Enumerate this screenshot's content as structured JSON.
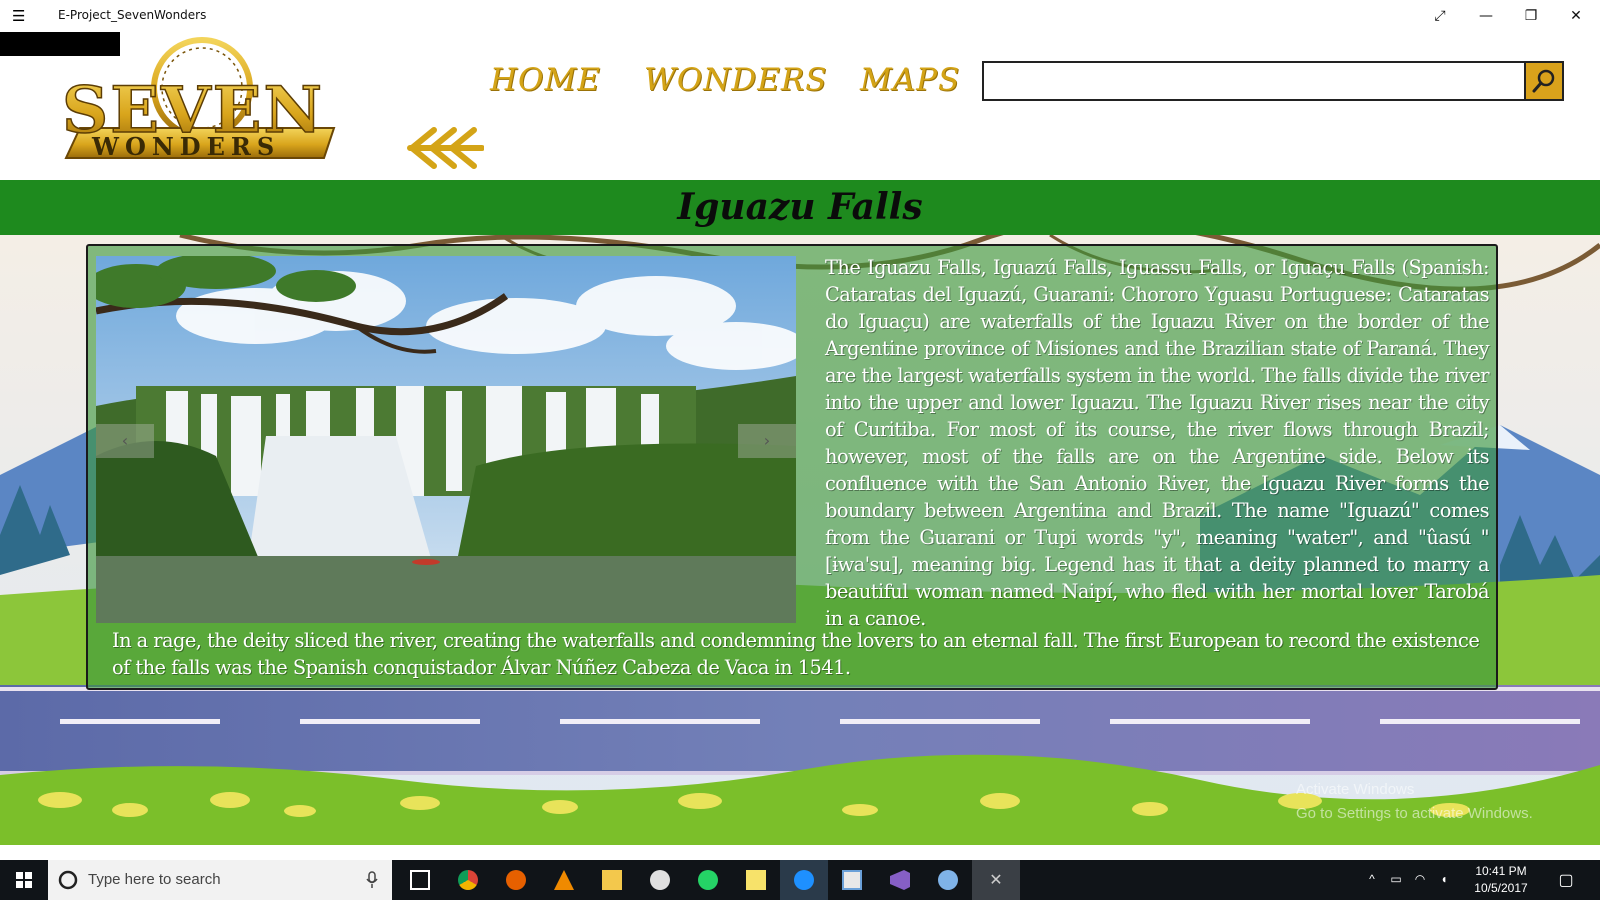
{
  "window": {
    "title": "E-Project_SevenWonders",
    "menu_icon": "hamburger-icon",
    "controls": [
      "expand-icon",
      "minimize-icon",
      "restore-icon",
      "close-icon"
    ]
  },
  "header": {
    "logo": {
      "line1": "SEVEN",
      "line2": "WONDERS"
    },
    "nav": [
      {
        "label": "HOME"
      },
      {
        "label": "WONDERS"
      },
      {
        "label": "MAPS"
      }
    ],
    "search": {
      "value": "",
      "placeholder": "",
      "icon": "search-icon"
    },
    "back_icon": "double-back-arrow-icon"
  },
  "page": {
    "title": "Iguazu Falls",
    "slider": {
      "prev_label": "‹",
      "next_label": "›"
    },
    "description_right": "The Iguazu Falls, Iguazú Falls, Iguassu Falls, or Iguaçu Falls (Spanish: Cataratas del Iguazú, Guarani: Chororo Yguasu Portuguese: Cataratas do Iguaçu) are waterfalls of the Iguazu River on the border of the Argentine province of Misiones and the Brazilian state of Paraná. They are the largest waterfalls system in the world. The falls divide the river into the upper and lower Iguazu. The Iguazu River rises near the city of Curitiba. For most of its course, the river flows through Brazil; however, most of the falls are on the Argentine side. Below its confluence with the San Antonio River, the Iguazu River forms the boundary between Argentina and Brazil. The name \"Iguazú\" comes from the Guarani or Tupi words \"y\", meaning \"water\", and \"ûasú \"[ɨwa'su], meaning big. Legend has it that a deity planned to marry a beautiful woman named Naipí, who fled with her mortal lover Tarobá in a canoe.",
    "description_bottom": "In a rage, the deity sliced the river, creating the waterfalls and condemning the lovers to an eternal fall. The first European to record the existence of the falls was the Spanish conquistador Álvar Núñez Cabeza de Vaca in 1541."
  },
  "watermark": {
    "line1": "Activate Windows",
    "line2": "Go to Settings to activate Windows."
  },
  "taskbar": {
    "search_placeholder": "Type here to search",
    "apps": [
      "task-view-icon",
      "chrome-icon",
      "firefox-icon",
      "vlc-icon",
      "file-explorer-icon",
      "paint-icon",
      "whatsapp-icon",
      "sticky-notes-icon",
      "messenger-icon",
      "media-icon",
      "visual-studio-icon",
      "paint-brush-icon",
      "app-close-icon"
    ],
    "time": "10:41 PM",
    "date": "10/5/2017"
  },
  "colors": {
    "gold": "#d4a417",
    "green_bar": "#1e8a1e",
    "panel_green": "#3a963a",
    "search_button": "#d9a21b"
  }
}
